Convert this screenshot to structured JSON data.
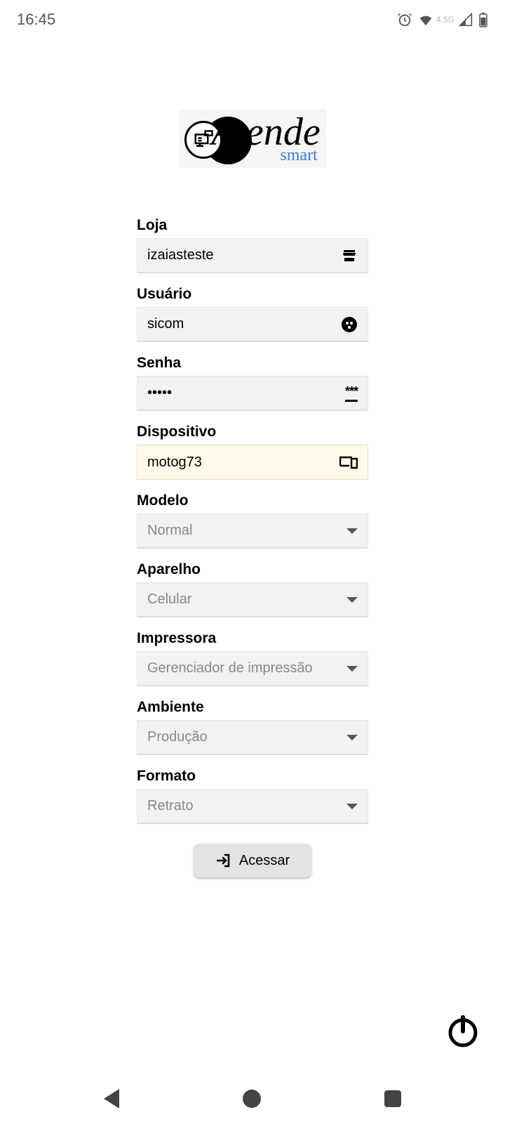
{
  "status": {
    "time": "16:45",
    "network_label": "4.5G"
  },
  "logo": {
    "main": "Atende",
    "sub": "smart"
  },
  "fields": {
    "loja": {
      "label": "Loja",
      "value": "izaiasteste"
    },
    "usuario": {
      "label": "Usuário",
      "value": "sicom"
    },
    "senha": {
      "label": "Senha",
      "value": "•••••"
    },
    "dispositivo": {
      "label": "Dispositivo",
      "value": "motog73"
    },
    "modelo": {
      "label": "Modelo",
      "value": "Normal"
    },
    "aparelho": {
      "label": "Aparelho",
      "value": "Celular"
    },
    "impressora": {
      "label": "Impressora",
      "value": "Gerenciador de impressão"
    },
    "ambiente": {
      "label": "Ambiente",
      "value": "Produção"
    },
    "formato": {
      "label": "Formato",
      "value": "Retrato"
    }
  },
  "actions": {
    "access": "Acessar"
  }
}
